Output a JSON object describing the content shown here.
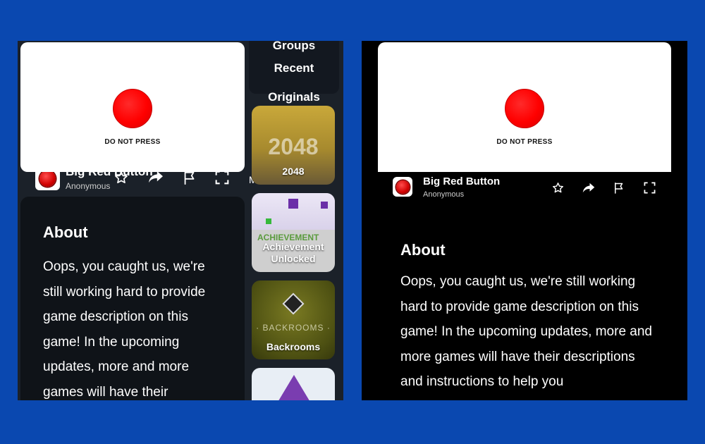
{
  "game": {
    "title": "Big Red Button",
    "author": "Anonymous",
    "button_caption": "DO NOT PRESS"
  },
  "actions": [
    "star-icon",
    "share-icon",
    "flag-icon",
    "fullscreen-icon"
  ],
  "about": {
    "heading": "About",
    "body": "Oops, you caught us, we're still working hard to provide game description on this game! In the upcoming updates, more and more games will have their descriptions and instructions to help you"
  },
  "left_menu": {
    "items": [
      "Groups",
      "Recent",
      "Originals"
    ],
    "partial_text": "Most Pla"
  },
  "game_tiles": [
    {
      "label": "2048",
      "art_text": "2048"
    },
    {
      "label": "Achievement Unlocked",
      "art_text": "ACHIEVEMENT"
    },
    {
      "label": "Backrooms",
      "art_text": "· BACKROOMS ·"
    },
    {
      "label": ""
    }
  ],
  "colors": {
    "page_bg": "#0a48b0",
    "left_bg": "#1b2129",
    "card_bg": "#0f1318",
    "right_bg": "#000000",
    "button_red": "#ff0000"
  }
}
